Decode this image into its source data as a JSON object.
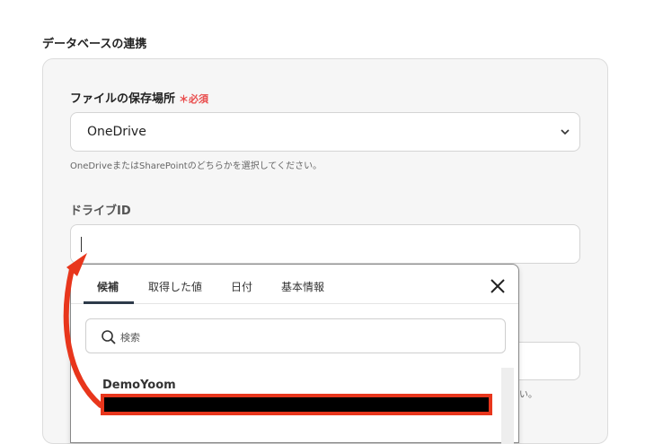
{
  "section": {
    "title": "データベースの連携"
  },
  "storage": {
    "label": "ファイルの保存場所",
    "required": "＊必須",
    "selected": "OneDrive",
    "help": "OneDriveまたはSharePointのどちらかを選択してください。"
  },
  "drive": {
    "label": "ドライブID",
    "value": ""
  },
  "popup": {
    "tabs": [
      "候補",
      "取得した値",
      "日付",
      "基本情報"
    ],
    "search_placeholder": "検索",
    "option_title": "DemoYoom"
  },
  "partial_help": "い。",
  "colors": {
    "accent_red": "#e8361c",
    "required_red": "#e94b4b",
    "tab_underline": "#2d3a4a"
  }
}
